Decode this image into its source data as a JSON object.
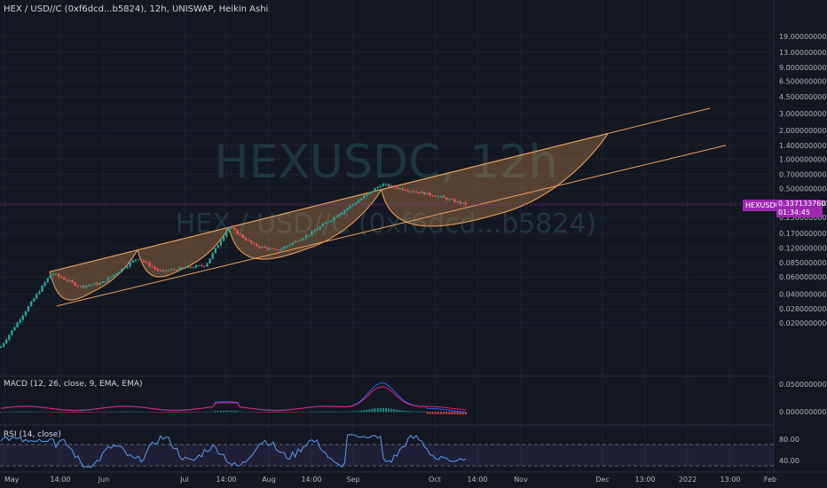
{
  "symbol_line": "HEX / USD//C (0xf6dcd...b5824), 12h, UNISWAP, Heikin Ashi",
  "watermark": {
    "line1": "HEXUSDC, 12h",
    "line2": "HEX / USD//C (0xf6dcd...b5824)"
  },
  "price_tag": {
    "symbol": "HEXUSDC",
    "price": "0.3371337601",
    "countdown": "01:34:45"
  },
  "macd_label": "MACD (12, 26, close, 9, EMA, EMA)",
  "rsi_label": "RSI (14, close)",
  "colors": {
    "up": "#26a69a",
    "down": "#ef5350",
    "pattern": "#f0a35b",
    "macd": "#2962ff",
    "signal": "#e91e63",
    "rsi": "#5b9cf6"
  },
  "chart_data": [
    {
      "type": "candlestick",
      "scale": "log",
      "y_ticks": [
        "19.0000000000",
        "13.0000000000",
        "9.0000000000",
        "6.5000000000",
        "4.5000000000",
        "3.0000000000",
        "2.0000000000",
        "1.4000000000",
        "1.0000000000",
        "0.7000000000",
        "0.5000000000",
        "0.3500000000",
        "0.2500000000",
        "0.1700000000",
        "0.1200000000",
        "0.0850000000",
        "0.0600000000",
        "0.0400000000",
        "0.0280000000",
        "0.0200000000"
      ],
      "x_ticks": [
        "May",
        "14:00",
        "Jun",
        "Jul",
        "14:00",
        "Aug",
        "14:00",
        "Sep",
        "Oct",
        "14:00",
        "Nov",
        "Dec",
        "13:00",
        "2022",
        "13:00",
        "Feb"
      ],
      "price_path": [
        {
          "x": "May",
          "y": 0.011
        },
        {
          "x": "14:00",
          "y": 0.066
        },
        {
          "x": "14:00",
          "y": 0.048
        },
        {
          "x": "Jun",
          "y": 0.052
        },
        {
          "x": "Jun",
          "y": 0.095
        },
        {
          "x": "Jun",
          "y": 0.068
        },
        {
          "x": "Jul",
          "y": 0.08
        },
        {
          "x": "Jul",
          "y": 0.2
        },
        {
          "x": "14:00",
          "y": 0.13
        },
        {
          "x": "Aug",
          "y": 0.112
        },
        {
          "x": "14:00",
          "y": 0.17
        },
        {
          "x": "Sep",
          "y": 0.55
        },
        {
          "x": "Oct",
          "y": 0.42
        },
        {
          "x": "Oct",
          "y": 0.337
        }
      ],
      "last_price": 0.3371337601,
      "channel_upper": [
        {
          "x": "14:00",
          "y": 0.068
        },
        {
          "x": "Dec",
          "y": 3.4
        }
      ],
      "channel_lower": [
        {
          "x": "14:00",
          "y": 0.03
        },
        {
          "x": "Dec",
          "y": 1.4
        }
      ]
    },
    {
      "type": "line",
      "title": "MACD (12, 26, close, 9, EMA, EMA)",
      "y_ticks": [
        "0.0500000000",
        "0.0000000000"
      ]
    },
    {
      "type": "line",
      "title": "RSI (14, close)",
      "y_ticks": [
        "80.00",
        "40.00"
      ]
    }
  ]
}
